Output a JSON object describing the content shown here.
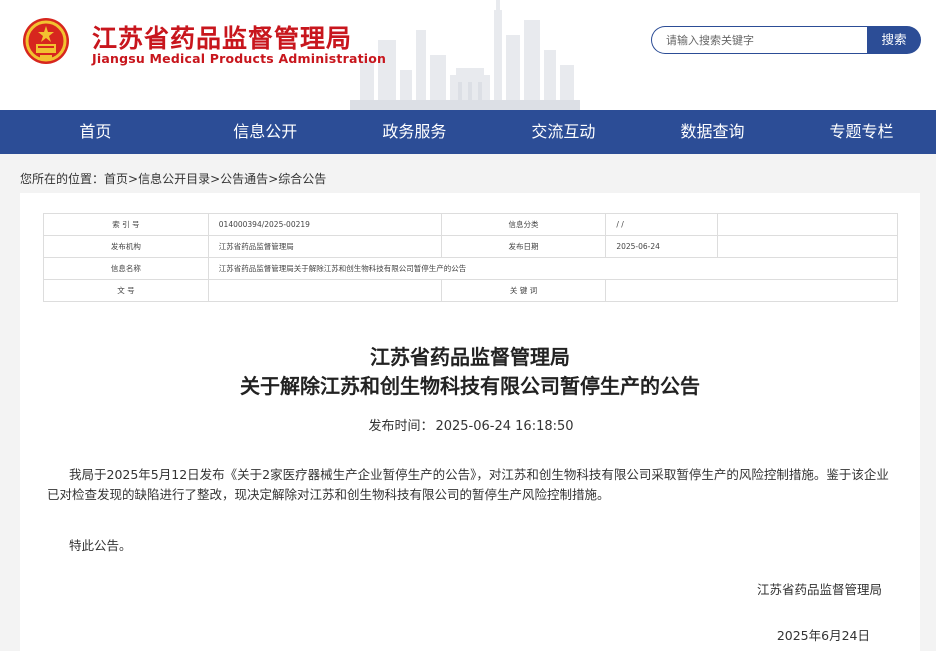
{
  "header": {
    "title_cn": "江苏省药品监督管理局",
    "title_en": "Jiangsu Medical Products Administration",
    "search_placeholder": "请输入搜索关键字",
    "search_button": "搜索",
    "brand_color": "#c8161d",
    "nav_color": "#2c4d96"
  },
  "nav": {
    "items": [
      "首页",
      "信息公开",
      "政务服务",
      "交流互动",
      "数据查询",
      "专题专栏"
    ]
  },
  "breadcrumb": {
    "prefix": "您所在的位置：",
    "items": [
      "首页",
      "信息公开目录",
      "公告通告",
      "综合公告"
    ],
    "separator": ">"
  },
  "meta": {
    "rows": [
      {
        "k1": "索 引 号",
        "v1": "014000394/2025-00219",
        "k2": "信息分类",
        "v2": "/  /"
      },
      {
        "k1": "发布机构",
        "v1": "江苏省药品监督管理局",
        "k2": "发布日期",
        "v2": "2025-06-24"
      },
      {
        "k1": "信息名称",
        "v1": "江苏省药品监督管理局关于解除江苏和创生物科技有限公司暂停生产的公告"
      },
      {
        "k1": "文    号",
        "v1": "",
        "k2": "关 键 词",
        "v2": ""
      }
    ]
  },
  "article": {
    "title_line1": "江苏省药品监督管理局",
    "title_line2": "关于解除江苏和创生物科技有限公司暂停生产的公告",
    "publish_label": "发布时间：",
    "publish_time": "2025-06-24 16:18:50",
    "paragraph1": "我局于2025年5月12日发布《关于2家医疗器械生产企业暂停生产的公告》，对江苏和创生物科技有限公司采取暂停生产的风险控制措施。鉴于该企业已对检查发现的缺陷进行了整改，现决定解除对江苏和创生物科技有限公司的暂停生产风险控制措施。",
    "closing": "特此公告。",
    "signature": "江苏省药品监督管理局",
    "date": "2025年6月24日"
  }
}
